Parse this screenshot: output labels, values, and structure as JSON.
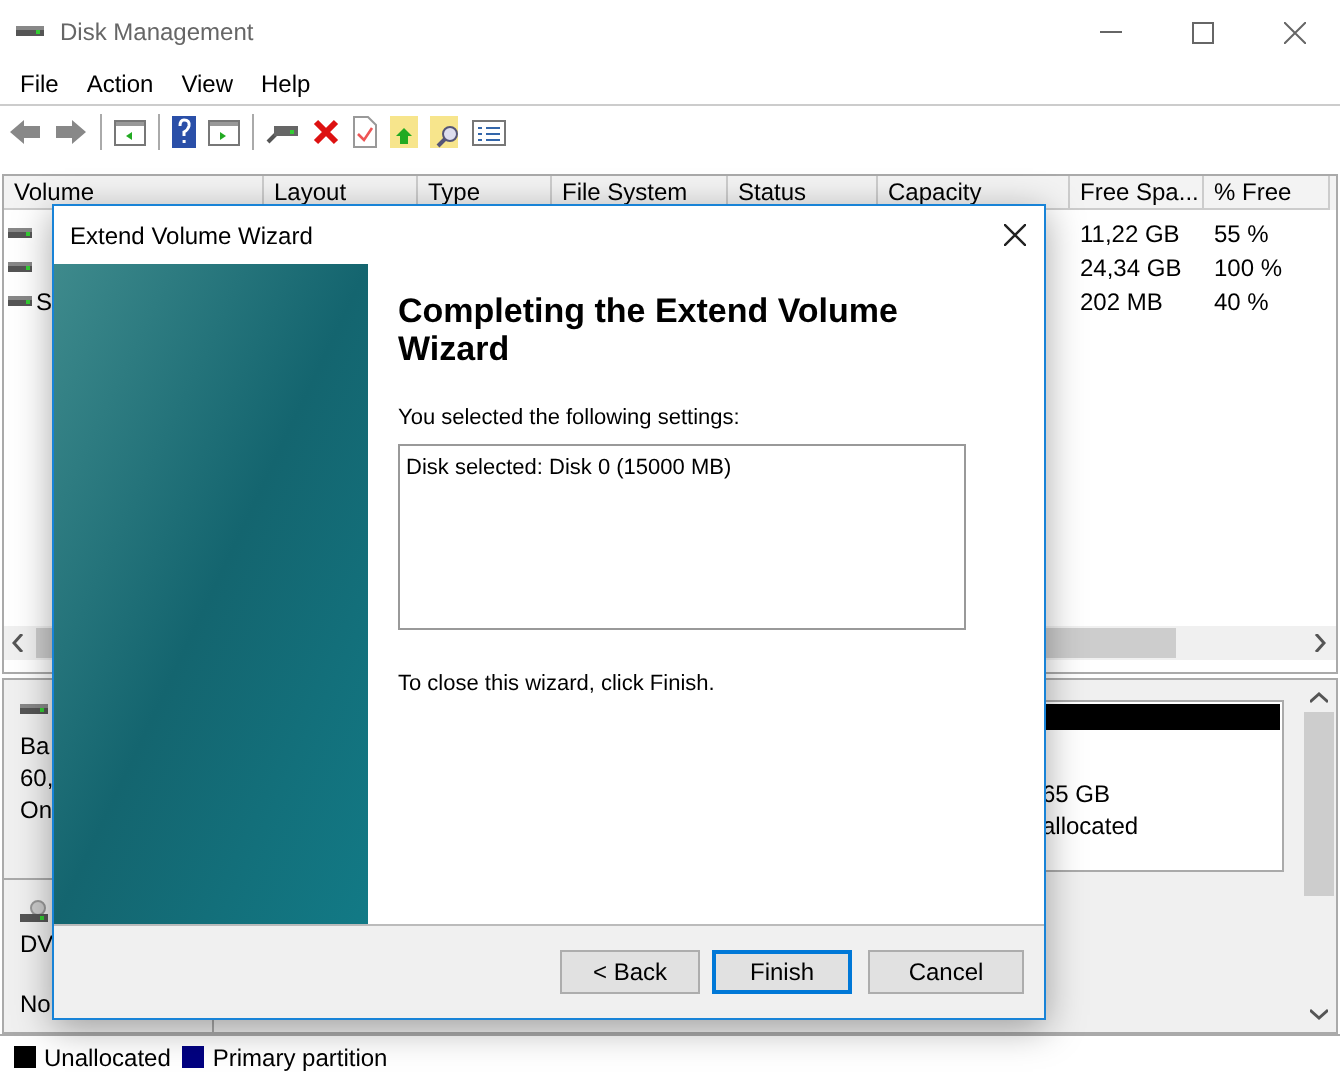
{
  "window": {
    "title": "Disk Management"
  },
  "menu": [
    "File",
    "Action",
    "View",
    "Help"
  ],
  "volume_table": {
    "columns": [
      "Volume",
      "Layout",
      "Type",
      "File System",
      "Status",
      "Capacity",
      "Free Spa...",
      "% Free"
    ],
    "rows": [
      {
        "free_space": "11,22 GB",
        "percent_free": "55 %"
      },
      {
        "free_space": "24,34 GB",
        "percent_free": "100 %"
      },
      {
        "volume": "S",
        "free_space": "202 MB",
        "percent_free": "40 %"
      }
    ]
  },
  "disks": [
    {
      "kind": "hdd",
      "lines": [
        "Ba",
        "60,",
        "On"
      ],
      "partition_lines": [
        "65 GB",
        "allocated"
      ]
    },
    {
      "kind": "cdrom",
      "lines": [
        "DV",
        "No"
      ]
    }
  ],
  "legend": [
    {
      "label": "Unallocated",
      "color": "#000000"
    },
    {
      "label": "Primary partition",
      "color": "#000080"
    }
  ],
  "dialog": {
    "title": "Extend Volume Wizard",
    "heading": "Completing the Extend Volume Wizard",
    "settings_label": "You selected the following settings:",
    "settings_text": "Disk selected: Disk 0 (15000 MB)",
    "closing_text": "To close this wizard, click Finish.",
    "buttons": [
      {
        "label": "< Back",
        "default": false
      },
      {
        "label": "Finish",
        "default": true
      },
      {
        "label": "Cancel",
        "default": false
      }
    ]
  }
}
